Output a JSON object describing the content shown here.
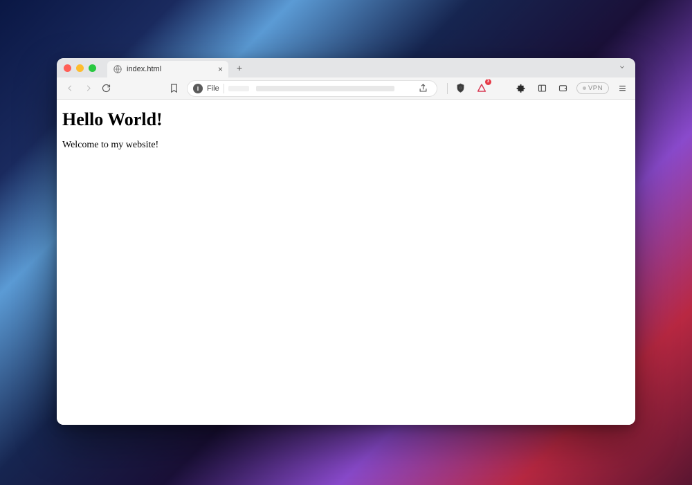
{
  "tab": {
    "title": "index.html"
  },
  "address": {
    "scheme_label": "File"
  },
  "toolbar": {
    "vpn_label": "VPN"
  },
  "page": {
    "heading": "Hello World!",
    "paragraph": "Welcome to my website!"
  },
  "rewards": {
    "badge_count": "3"
  }
}
